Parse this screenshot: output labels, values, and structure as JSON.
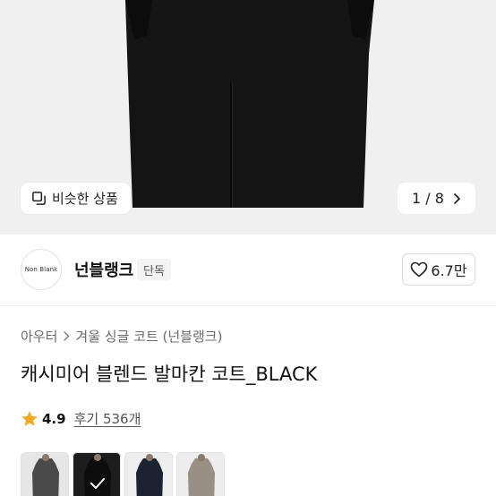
{
  "gallery": {
    "similar_label": "비슷한 상품",
    "page_current": "1",
    "page_separator": "/",
    "page_total": "8",
    "background": "#f0f0f0",
    "coat_color": "#141414"
  },
  "brand": {
    "logo_text": "Non Blank",
    "name": "넌블랭크",
    "tag": "단독",
    "likes": "6.7만"
  },
  "product": {
    "breadcrumb": [
      "아우터",
      "겨울 싱글 코트 (넌블랭크)"
    ],
    "title": "캐시미어 블렌드 발마칸 코트_BLACK",
    "rating": "4.9",
    "reviews": "후기 536개",
    "star_color": "#f5a623"
  },
  "colors": [
    {
      "name": "charcoal",
      "bg": "#e6e6e6",
      "coat": "#4a4a4a",
      "selected": false
    },
    {
      "name": "black",
      "bg": "#1d1d1d",
      "coat": "#0d0d0d",
      "selected": true
    },
    {
      "name": "navy",
      "bg": "#eeeeee",
      "coat": "#1b2230",
      "selected": false
    },
    {
      "name": "beige",
      "bg": "#ededed",
      "coat": "#9a8f84",
      "selected": false
    }
  ]
}
